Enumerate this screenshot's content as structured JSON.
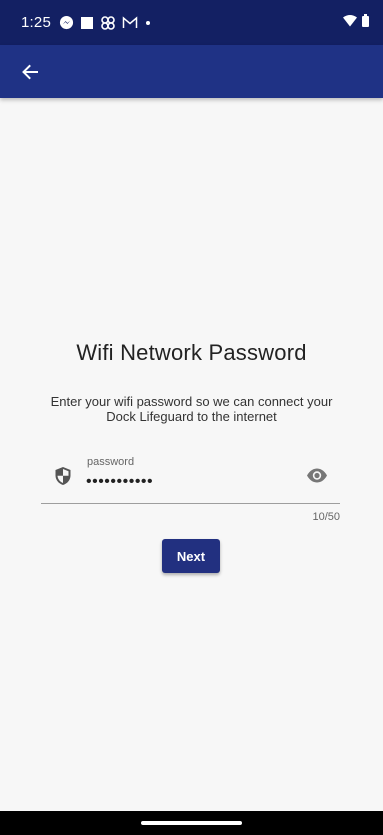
{
  "status_bar": {
    "time": "1:25",
    "notification_icons": [
      "messenger-icon",
      "square-icon",
      "pinwheel-icon",
      "gmail-icon",
      "dot-icon"
    ],
    "system_icons": [
      "wifi-icon",
      "battery-icon"
    ]
  },
  "app_bar": {
    "back_icon": "arrow-left-icon"
  },
  "page": {
    "title": "Wifi Network Password",
    "description": "Enter your wifi password so we can connect your Dock Lifeguard to the internet"
  },
  "password_field": {
    "label": "password",
    "value": "•••••••••••",
    "counter": "10/50",
    "leading_icon": "shield-icon",
    "trailing_icon": "eye-icon"
  },
  "actions": {
    "next_label": "Next"
  },
  "colors": {
    "status_bar": "#132063",
    "app_bar": "#1f3285",
    "button": "#223080",
    "background": "#f7f7f7"
  }
}
